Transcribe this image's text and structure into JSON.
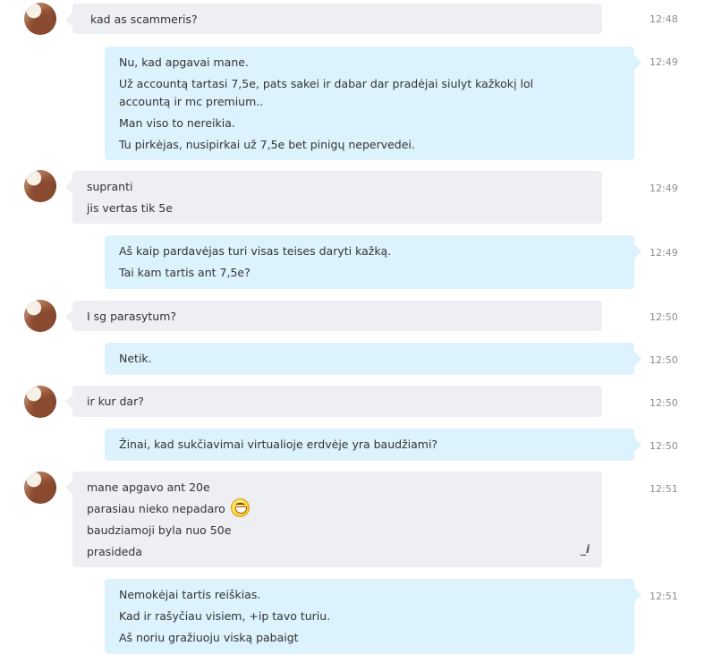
{
  "messages": [
    {
      "lines": [
        "kad as scammeris?"
      ],
      "time": "12:48"
    },
    {
      "lines": [
        "Nu, kad apgavai mane.",
        "Už accountą tartasi 7,5e, pats sakei ir dabar dar pradėjai siulyt kažkokį lol accountą ir mc premium..",
        "Man viso to nereikia.",
        "Tu pirkėjas, nusipirkai už 7,5e bet pinigų nepervedei."
      ],
      "time": "12:49"
    },
    {
      "lines": [
        "supranti",
        "jis vertas tik 5e"
      ],
      "time": "12:49"
    },
    {
      "lines": [
        "Aš kaip pardavėjas turi visas teises daryti kažką.",
        "Tai kam tartis ant 7,5e?"
      ],
      "time": "12:49"
    },
    {
      "lines": [
        "I sg parasytum?"
      ],
      "time": "12:50"
    },
    {
      "lines": [
        "Netik."
      ],
      "time": "12:50"
    },
    {
      "lines": [
        "ir kur dar?"
      ],
      "time": "12:50"
    },
    {
      "lines": [
        "Žinai, kad sukčiavimai virtualioje erdvėje yra baudžiami?"
      ],
      "time": "12:50"
    },
    {
      "lines": [
        "mane apgavo ant 20e",
        "parasiau nieko nepadaro",
        "baudziamoji byla nuo 50e",
        "prasideda"
      ],
      "time": "12:51",
      "emoji": "grinning-emoji-icon",
      "edit_mark": "_i"
    },
    {
      "lines": [
        "Nemokėjai tartis reiškias.",
        "Kad ir rašyčiau visiem, +ip tavo turiu.",
        "Aš noriu gražiuoju viską pabaigt"
      ],
      "time": "12:51"
    }
  ]
}
